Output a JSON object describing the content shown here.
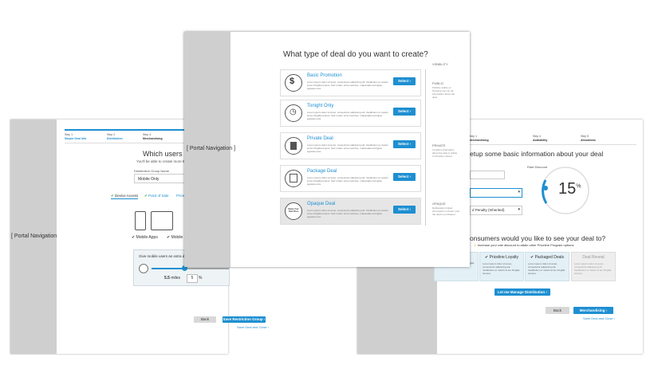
{
  "left": {
    "portal_label": "[ Portal Navigation ]",
    "steps": [
      {
        "num": "Step 1",
        "label": "Simple Deal Info"
      },
      {
        "num": "Step 2",
        "label": "Distribution"
      },
      {
        "num": "Step 3",
        "label": "Merchandising"
      },
      {
        "num": "Step 4",
        "label": "Ava"
      }
    ],
    "heading": "Which users can s",
    "subheading": "You'll be able to create more tha",
    "group_name_label": "Distribution Group Name",
    "group_name_value": "Mobile Only",
    "access_tabs": [
      "Device Access",
      "Point of Sale",
      "Priceline L"
    ],
    "checks": [
      "Mobile Apps",
      "Mobile We"
    ],
    "tooltip_text": "Give mobile users an extra dis",
    "slider_value": "5.5",
    "slider_unit": "miles",
    "percent_value": "5",
    "percent_sign": "%",
    "back_label": "Back",
    "save_label": "Save Restriction Group ›",
    "save_link": "Save Deal and Close ›"
  },
  "right": {
    "steps": [
      {
        "num": "Step 1",
        "label": "Merchandising"
      },
      {
        "num": "Step 4",
        "label": "Availability"
      },
      {
        "num": "Step 5",
        "label": "Allocations"
      }
    ],
    "heading": "etup some basic information about your deal",
    "rate_discount_label": "Rate Discount",
    "rate_value": "15",
    "rate_unit": "%",
    "penalty_text": "d Penalty (Inherited)",
    "question": "onsumers would you like to see your deal to?",
    "warning": "Increase your rate discount to attain other Priceline Program options",
    "cards": [
      {
        "title": "",
        "desc": "Lorem ipsum dolor sit amet, consectetur adipiscing elit. Vestibulum et mauris at leo fringilla tempus."
      },
      {
        "title": "✔ Priceline Loyalty",
        "desc": "Lorem ipsum dolor sit amet, consectetur adipiscing elit. Vestibulum et mauris at leo fringilla tempus."
      },
      {
        "title": "✔ Packaged Deals",
        "desc": "Lorem ipsum dolor sit amet, consectetur adipiscing elit. Vestibulum et mauris at leo fringilla tempus."
      },
      {
        "title": "Deal Reveal",
        "desc": "Lorem ipsum dolor sit amet, consectetur adipiscing elit. Vestibulum et mauris at leo fringilla tempus."
      }
    ],
    "manage_label": "Let me Manage Distribution ›",
    "back_label": "Back",
    "merch_label": "Merchandising ›",
    "save_link": "Save Deal and Close ›"
  },
  "front": {
    "portal_label": "[ Portal Navigation ]",
    "title": "What type of deal do you want to create?",
    "deals": [
      {
        "title": "Basic Promotion",
        "desc": "Lorem ipsum dolor sit amet, consectetur adipiscing elit. Vestibulum et mauris at leo fringilla tempus. Sed ornare urna maximus, malesuada est ligula, egestas eros.",
        "select": "Select ›"
      },
      {
        "title": "Tonight Only",
        "desc": "Lorem ipsum dolor sit amet, consectetur adipiscing elit. Vestibulum et mauris at leo fringilla tempus. Sed ornare urna maximus, malesuada est ligula, egestas eros.",
        "select": "Select ›"
      },
      {
        "title": "Private Deal",
        "desc": "Lorem ipsum dolor sit amet, consectetur adipiscing elit. Vestibulum et mauris at leo fringilla tempus. Sed ornare urna maximus, malesuada est ligula, egestas eros.",
        "select": "Select ›"
      },
      {
        "title": "Package Deal",
        "desc": "Lorem ipsum dolor sit amet, consectetur adipiscing elit. Vestibulum et mauris at leo fringilla tempus. Sed ornare urna maximus, malesuada est ligula, egestas eros.",
        "select": "Select ›"
      },
      {
        "title": "Opaque Deal",
        "desc": "Lorem ipsum dolor sit amet, consectetur adipiscing elit. Vestibulum et mauris at leo fringilla tempus. Sed ornare urna maximus, malesuada est ligula, egestas eros.",
        "select": "Select ›"
      }
    ],
    "opaque_icon_text": "Name Your Own Price",
    "visibility_label": "VISIBILITY",
    "public_label": "PUBLIC",
    "public_note": "Publicly visible on Priceline.com for all information about the deal",
    "private_label": "PRIVATE",
    "private_note": "Contains information about the deal is visible to Priceline visitors",
    "opaque_label": "OPAQUE",
    "opaque_note": "Deliberately limited information is shown until the deal is purchased"
  }
}
